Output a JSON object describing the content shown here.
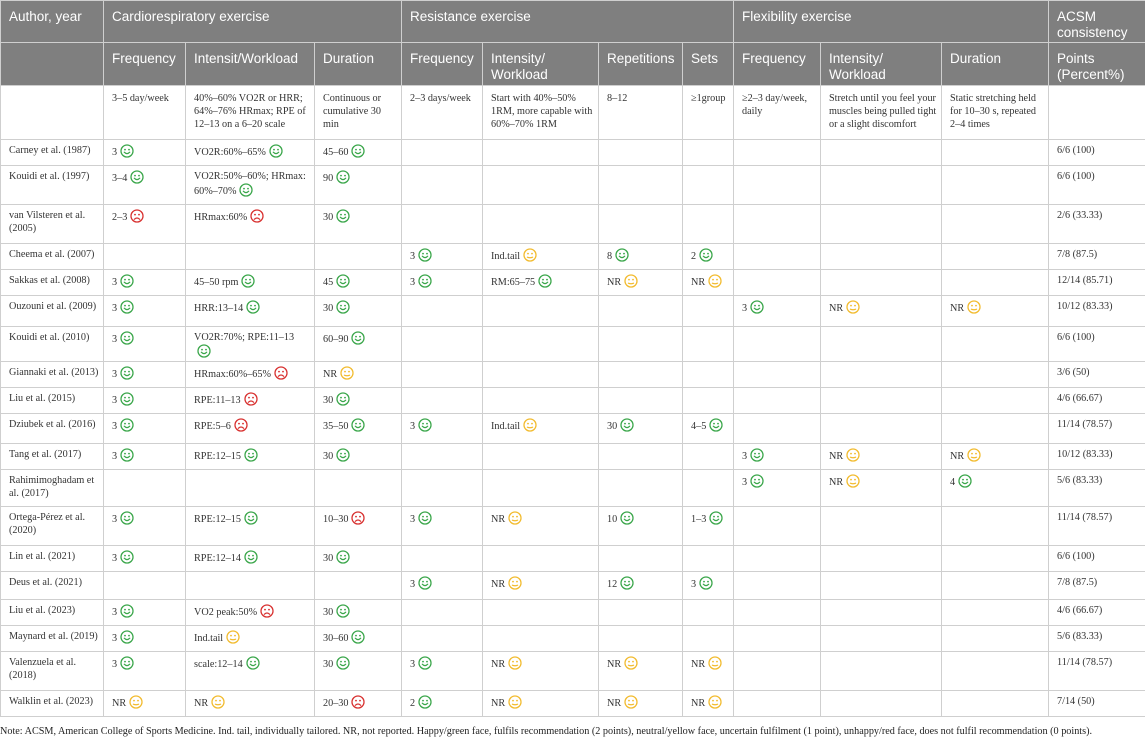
{
  "header": {
    "author_year": "Author, year",
    "cardio": "Cardiorespiratory exercise",
    "resistance": "Resistance exercise",
    "flexibility": "Flexibility exercise",
    "acsm": "ACSM consistency",
    "sub": [
      "Frequency",
      "Intensit/Workload",
      "Duration",
      "Frequency",
      "Intensity/ Workload",
      "Repetitions",
      "Sets",
      "Frequency",
      "Intensity/ Workload",
      "Duration",
      "Points (Percent%)"
    ]
  },
  "recommendation": [
    "",
    "3–5 day/week",
    "40%–60% VO2R or HRR; 64%–76% HRmax; RPE of 12–13 on a 6–20 scale",
    "Continuous or cumulative 30 min",
    "2–3 days/week",
    "Start with 40%–50% 1RM, more capable with 60%–70% 1RM",
    "8–12",
    "≥1group",
    "≥2–3 day/week, daily",
    "Stretch until you feel your muscles being pulled tight or a slight discomfort",
    "Static stretching held for 10–30 s, repeated 2–4 times",
    ""
  ],
  "face_colors": {
    "green": "#3aa64a",
    "yellow": "#f2bb2e",
    "red": "#d8302f"
  },
  "rows": [
    {
      "author": "Carney et al. (1987)",
      "cells": [
        {
          "t": "3",
          "f": "green"
        },
        {
          "t": "VO2R:60%–65%",
          "f": "green"
        },
        {
          "t": "45–60",
          "f": "green"
        },
        {
          "t": ""
        },
        {
          "t": ""
        },
        {
          "t": ""
        },
        {
          "t": ""
        },
        {
          "t": ""
        },
        {
          "t": ""
        },
        {
          "t": ""
        }
      ],
      "points": "6/6 (100)"
    },
    {
      "author": "Kouidi et al. (1997)",
      "cells": [
        {
          "t": "3–4",
          "f": "green"
        },
        {
          "t": "VO2R:50%–60%; HRmax: 60%–70%",
          "f": "green"
        },
        {
          "t": "90",
          "f": "green"
        },
        {
          "t": ""
        },
        {
          "t": ""
        },
        {
          "t": ""
        },
        {
          "t": ""
        },
        {
          "t": ""
        },
        {
          "t": ""
        },
        {
          "t": ""
        }
      ],
      "points": "6/6 (100)"
    },
    {
      "author": "van Vilsteren et al. (2005)",
      "cells": [
        {
          "t": "2–3",
          "f": "red"
        },
        {
          "t": "HRmax:60%",
          "f": "red"
        },
        {
          "t": "30",
          "f": "green"
        },
        {
          "t": ""
        },
        {
          "t": ""
        },
        {
          "t": ""
        },
        {
          "t": ""
        },
        {
          "t": ""
        },
        {
          "t": ""
        },
        {
          "t": ""
        }
      ],
      "points": "2/6 (33.33)"
    },
    {
      "author": "Cheema et al. (2007)",
      "cells": [
        {
          "t": ""
        },
        {
          "t": ""
        },
        {
          "t": ""
        },
        {
          "t": "3",
          "f": "green"
        },
        {
          "t": "Ind.tail",
          "f": "yellow"
        },
        {
          "t": "8",
          "f": "green"
        },
        {
          "t": "2",
          "f": "green"
        },
        {
          "t": ""
        },
        {
          "t": ""
        },
        {
          "t": ""
        }
      ],
      "points": "7/8 (87.5)"
    },
    {
      "author": "Sakkas et al. (2008)",
      "cells": [
        {
          "t": "3",
          "f": "green"
        },
        {
          "t": "45–50 rpm",
          "f": "green"
        },
        {
          "t": "45",
          "f": "green"
        },
        {
          "t": "3",
          "f": "green"
        },
        {
          "t": "RM:65–75",
          "f": "green"
        },
        {
          "t": "NR",
          "f": "yellow"
        },
        {
          "t": "NR",
          "f": "yellow"
        },
        {
          "t": ""
        },
        {
          "t": ""
        },
        {
          "t": ""
        }
      ],
      "points": "12/14 (85.71)"
    },
    {
      "author": "Ouzouni et al. (2009)",
      "cells": [
        {
          "t": "3",
          "f": "green"
        },
        {
          "t": "HRR:13–14",
          "f": "green"
        },
        {
          "t": "30",
          "f": "green"
        },
        {
          "t": ""
        },
        {
          "t": ""
        },
        {
          "t": ""
        },
        {
          "t": ""
        },
        {
          "t": "3",
          "f": "green"
        },
        {
          "t": "NR",
          "f": "yellow"
        },
        {
          "t": "NR",
          "f": "yellow"
        }
      ],
      "points": "10/12 (83.33)"
    },
    {
      "author": "Kouidi et al. (2010)",
      "cells": [
        {
          "t": "3",
          "f": "green"
        },
        {
          "t": "VO2R:70%; RPE:11–13",
          "f": "green"
        },
        {
          "t": "60–90",
          "f": "green"
        },
        {
          "t": ""
        },
        {
          "t": ""
        },
        {
          "t": ""
        },
        {
          "t": ""
        },
        {
          "t": ""
        },
        {
          "t": ""
        },
        {
          "t": ""
        }
      ],
      "points": "6/6 (100)"
    },
    {
      "author": "Giannaki et al. (2013)",
      "cells": [
        {
          "t": "3",
          "f": "green"
        },
        {
          "t": "HRmax:60%–65%",
          "f": "red"
        },
        {
          "t": "NR",
          "f": "yellow"
        },
        {
          "t": ""
        },
        {
          "t": ""
        },
        {
          "t": ""
        },
        {
          "t": ""
        },
        {
          "t": ""
        },
        {
          "t": ""
        },
        {
          "t": ""
        }
      ],
      "points": "3/6 (50)"
    },
    {
      "author": "Liu et al. (2015)",
      "cells": [
        {
          "t": "3",
          "f": "green"
        },
        {
          "t": "RPE:11–13",
          "f": "red"
        },
        {
          "t": "30",
          "f": "green"
        },
        {
          "t": ""
        },
        {
          "t": ""
        },
        {
          "t": ""
        },
        {
          "t": ""
        },
        {
          "t": ""
        },
        {
          "t": ""
        },
        {
          "t": ""
        }
      ],
      "points": "4/6 (66.67)"
    },
    {
      "author": "Dziubek et al. (2016)",
      "cells": [
        {
          "t": "3",
          "f": "green"
        },
        {
          "t": "RPE:5–6",
          "f": "red"
        },
        {
          "t": "35–50",
          "f": "green"
        },
        {
          "t": "3",
          "f": "green"
        },
        {
          "t": "Ind.tail",
          "f": "yellow"
        },
        {
          "t": "30",
          "f": "green"
        },
        {
          "t": "4–5",
          "f": "green"
        },
        {
          "t": ""
        },
        {
          "t": ""
        },
        {
          "t": ""
        }
      ],
      "points": "11/14 (78.57)"
    },
    {
      "author": "Tang et al. (2017)",
      "cells": [
        {
          "t": "3",
          "f": "green"
        },
        {
          "t": "RPE:12–15",
          "f": "green"
        },
        {
          "t": "30",
          "f": "green"
        },
        {
          "t": ""
        },
        {
          "t": ""
        },
        {
          "t": ""
        },
        {
          "t": ""
        },
        {
          "t": "3",
          "f": "green"
        },
        {
          "t": "NR",
          "f": "yellow"
        },
        {
          "t": "NR",
          "f": "yellow"
        }
      ],
      "points": "10/12 (83.33)"
    },
    {
      "author": "Rahimimoghadam et al. (2017)",
      "cells": [
        {
          "t": ""
        },
        {
          "t": ""
        },
        {
          "t": ""
        },
        {
          "t": ""
        },
        {
          "t": ""
        },
        {
          "t": ""
        },
        {
          "t": ""
        },
        {
          "t": "3",
          "f": "green"
        },
        {
          "t": "NR",
          "f": "yellow"
        },
        {
          "t": "4",
          "f": "green"
        }
      ],
      "points": "5/6 (83.33)"
    },
    {
      "author": "Ortega-Pérez et al. (2020)",
      "cells": [
        {
          "t": "3",
          "f": "green"
        },
        {
          "t": "RPE:12–15",
          "f": "green"
        },
        {
          "t": "10–30",
          "f": "red"
        },
        {
          "t": "3",
          "f": "green"
        },
        {
          "t": "NR",
          "f": "yellow"
        },
        {
          "t": "10",
          "f": "green"
        },
        {
          "t": "1–3",
          "f": "green"
        },
        {
          "t": ""
        },
        {
          "t": ""
        },
        {
          "t": ""
        }
      ],
      "points": "11/14 (78.57)"
    },
    {
      "author": "Lin et al. (2021)",
      "cells": [
        {
          "t": "3",
          "f": "green"
        },
        {
          "t": "RPE:12–14",
          "f": "green"
        },
        {
          "t": "30",
          "f": "green"
        },
        {
          "t": ""
        },
        {
          "t": ""
        },
        {
          "t": ""
        },
        {
          "t": ""
        },
        {
          "t": ""
        },
        {
          "t": ""
        },
        {
          "t": ""
        }
      ],
      "points": "6/6 (100)"
    },
    {
      "author": "Deus et al. (2021)",
      "cells": [
        {
          "t": ""
        },
        {
          "t": ""
        },
        {
          "t": ""
        },
        {
          "t": "3",
          "f": "green"
        },
        {
          "t": "NR",
          "f": "yellow"
        },
        {
          "t": "12",
          "f": "green"
        },
        {
          "t": "3",
          "f": "green"
        },
        {
          "t": ""
        },
        {
          "t": ""
        },
        {
          "t": ""
        }
      ],
      "points": "7/8 (87.5)"
    },
    {
      "author": "Liu et al. (2023)",
      "cells": [
        {
          "t": "3",
          "f": "green"
        },
        {
          "t": "VO2 peak:50%",
          "f": "red"
        },
        {
          "t": "30",
          "f": "green"
        },
        {
          "t": ""
        },
        {
          "t": ""
        },
        {
          "t": ""
        },
        {
          "t": ""
        },
        {
          "t": ""
        },
        {
          "t": ""
        },
        {
          "t": ""
        }
      ],
      "points": "4/6 (66.67)"
    },
    {
      "author": "Maynard et al. (2019)",
      "cells": [
        {
          "t": "3",
          "f": "green"
        },
        {
          "t": "Ind.tail",
          "f": "yellow"
        },
        {
          "t": "30–60",
          "f": "green"
        },
        {
          "t": ""
        },
        {
          "t": ""
        },
        {
          "t": ""
        },
        {
          "t": ""
        },
        {
          "t": ""
        },
        {
          "t": ""
        },
        {
          "t": ""
        }
      ],
      "points": "5/6 (83.33)"
    },
    {
      "author": "Valenzuela et al. (2018)",
      "cells": [
        {
          "t": "3",
          "f": "green"
        },
        {
          "t": "scale:12–14",
          "f": "green"
        },
        {
          "t": "30",
          "f": "green"
        },
        {
          "t": "3",
          "f": "green"
        },
        {
          "t": "NR",
          "f": "yellow"
        },
        {
          "t": "NR",
          "f": "yellow"
        },
        {
          "t": "NR",
          "f": "yellow"
        },
        {
          "t": ""
        },
        {
          "t": ""
        },
        {
          "t": ""
        }
      ],
      "points": "11/14 (78.57)"
    },
    {
      "author": "Walklin et al. (2023)",
      "cells": [
        {
          "t": "NR",
          "f": "yellow"
        },
        {
          "t": "NR",
          "f": "yellow"
        },
        {
          "t": "20–30",
          "f": "red"
        },
        {
          "t": "2",
          "f": "green"
        },
        {
          "t": "NR",
          "f": "yellow"
        },
        {
          "t": "NR",
          "f": "yellow"
        },
        {
          "t": "NR",
          "f": "yellow"
        },
        {
          "t": ""
        },
        {
          "t": ""
        },
        {
          "t": ""
        }
      ],
      "points": "7/14 (50)"
    }
  ],
  "note": "Note: ACSM, American College of Sports Medicine. Ind. tail, individually tailored. NR, not reported. Happy/green face, fulfils recommendation (2 points), neutral/yellow face, uncertain fulfilment (1 point), unhappy/red face, does not fulfil recommendation (0 points)."
}
